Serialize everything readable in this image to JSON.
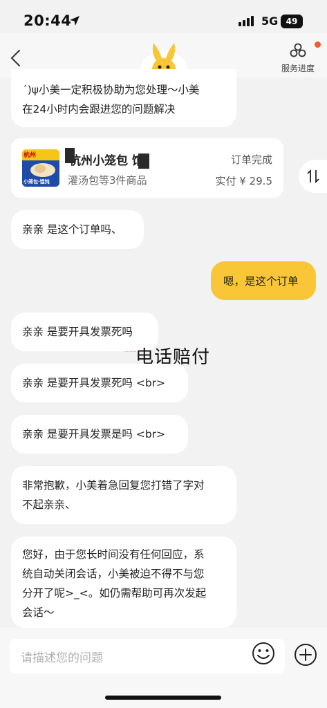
{
  "status_bar": {
    "time": "20:44",
    "network": "5G",
    "battery": "49"
  },
  "header": {
    "service_label": "服务进度"
  },
  "messages": {
    "m1": {
      "line1": "´)ψ小美一定积极协助为您处理～小美",
      "line2": "在24小时内会跟进您的问题解决"
    },
    "order": {
      "shop_name": "杭州小笼包  馆",
      "items": "灌汤包等3件商品",
      "status": "订单完成",
      "paid": "实付 ¥ 29.5",
      "thumb_top": "杭州",
      "thumb_bottom": "小笼包·馄饨"
    },
    "m2": "亲亲  是这个订单吗、",
    "user1": "嗯，是这个订单",
    "m3": "亲亲  是要开具发票死吗",
    "m4": "亲亲  是要开具发票死吗 <br>",
    "m5": "亲亲 是要开具发票是吗  <br>",
    "m6": {
      "line1": "非常抱歉，小美着急回复您打错了字对",
      "line2": "不起亲亲、"
    },
    "m7": {
      "line1": "您好，由于您长时间没有任何回应，系",
      "line2": "统自动关闭会话，小美被迫不得不与您",
      "line3": "分开了呢>_<。如仍需帮助可再次发起",
      "line4": "会话～"
    }
  },
  "watermark": {
    "big": "电话赔付"
  },
  "input": {
    "placeholder": "请描述您的问题"
  },
  "colors": {
    "accent": "#f9c637",
    "background": "#f2f2f2",
    "bubble": "#ffffff"
  }
}
